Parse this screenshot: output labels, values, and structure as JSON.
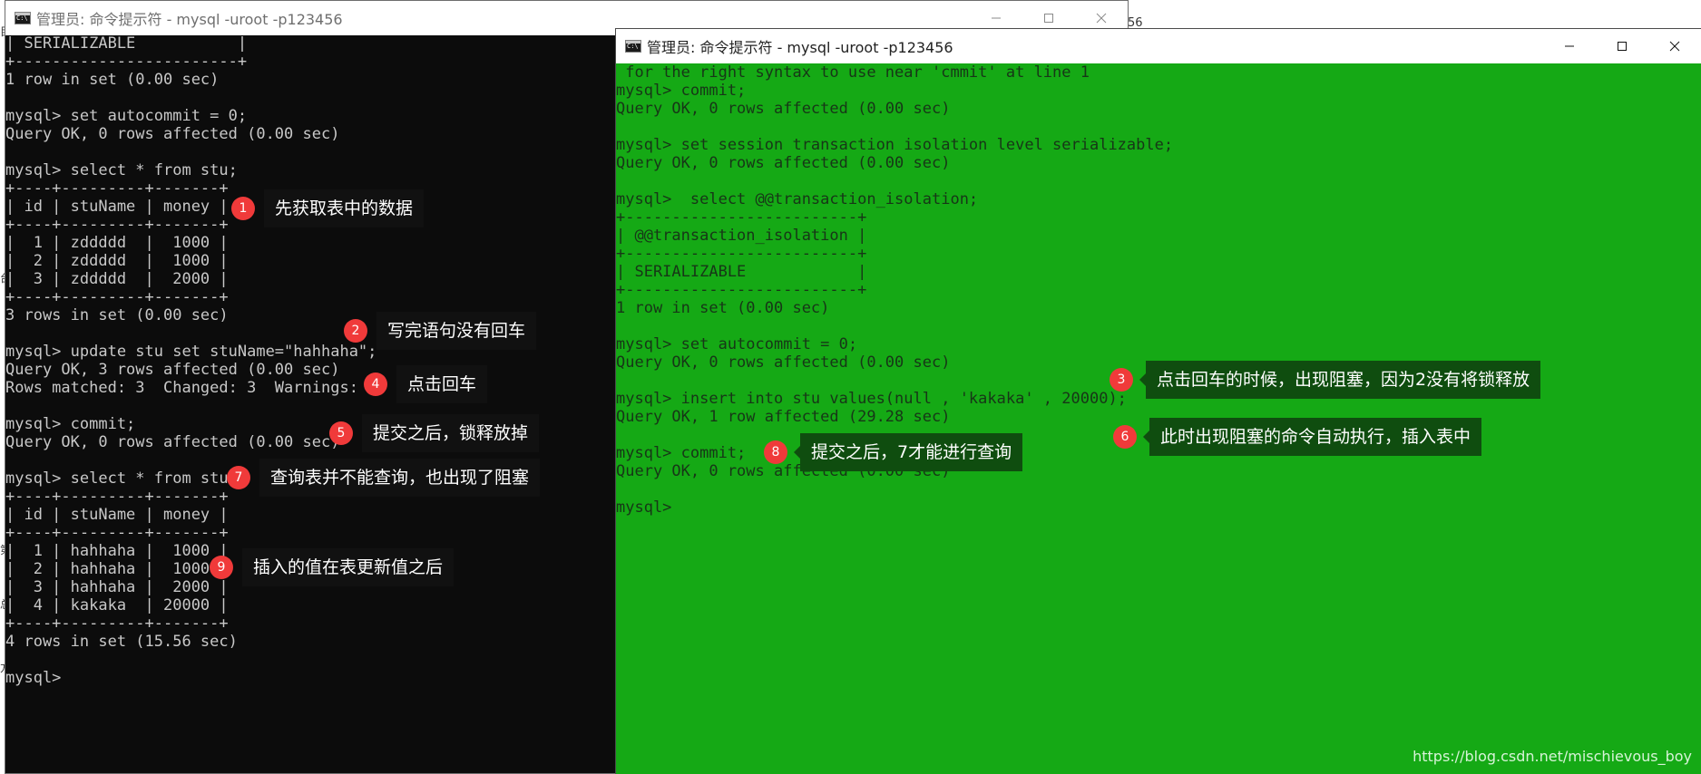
{
  "background": {
    "left_edge_chars": [
      "目",
      "台",
      "第",
      "总",
      "方"
    ],
    "top_right_fragment": "56"
  },
  "window1": {
    "title": "管理员: 命令提示符 - mysql  -uroot -p123456",
    "console_lines": [
      "| SERIALIZABLE           |",
      "+------------------------+",
      "1 row in set (0.00 sec)",
      "",
      "mysql> set autocommit = 0;",
      "Query OK, 0 rows affected (0.00 sec)",
      "",
      "mysql> select * from stu;",
      "+----+---------+-------+",
      "| id | stuName | money |",
      "+----+---------+-------+",
      "|  1 | zddddd  |  1000 |",
      "|  2 | zddddd  |  1000 |",
      "|  3 | zddddd  |  2000 |",
      "+----+---------+-------+",
      "3 rows in set (0.00 sec)",
      "",
      "mysql> update stu set stuName=\"hahhaha\";",
      "Query OK, 3 rows affected (0.00 sec)",
      "Rows matched: 3  Changed: 3  Warnings: 0",
      "",
      "mysql> commit;",
      "Query OK, 0 rows affected (0.00 sec)",
      "",
      "mysql> select * from stu;",
      "+----+---------+-------+",
      "| id | stuName | money |",
      "+----+---------+-------+",
      "|  1 | hahhaha |  1000 |",
      "|  2 | hahhaha |  1000 |",
      "|  3 | hahhaha |  2000 |",
      "|  4 | kakaka  | 20000 |",
      "+----+---------+-------+",
      "4 rows in set (15.56 sec)",
      "",
      "mysql> "
    ]
  },
  "window2": {
    "title": "管理员: 命令提示符 - mysql  -uroot -p123456",
    "console_lines": [
      " for the right syntax to use near 'cmmit' at line 1",
      "mysql> commit;",
      "Query OK, 0 rows affected (0.00 sec)",
      "",
      "mysql> set session transaction isolation level serializable;",
      "Query OK, 0 rows affected (0.00 sec)",
      "",
      "mysql>  select @@transaction_isolation;",
      "+-------------------------+",
      "| @@transaction_isolation |",
      "+-------------------------+",
      "| SERIALIZABLE            |",
      "+-------------------------+",
      "1 row in set (0.00 sec)",
      "",
      "mysql> set autocommit = 0;",
      "Query OK, 0 rows affected (0.00 sec)",
      "",
      "mysql> insert into stu values(null , 'kakaka' , 20000);",
      "Query OK, 1 row affected (29.28 sec)",
      "",
      "mysql> commit;",
      "Query OK, 0 rows affected (0.00 sec)",
      "",
      "mysql> "
    ]
  },
  "callouts": [
    {
      "num": "1",
      "text": "先获取表中的数据"
    },
    {
      "num": "2",
      "text": "写完语句没有回车"
    },
    {
      "num": "3",
      "text": "点击回车的时候，出现阻塞，因为2没有将锁释放"
    },
    {
      "num": "4",
      "text": "点击回车"
    },
    {
      "num": "5",
      "text": "提交之后，锁释放掉"
    },
    {
      "num": "6",
      "text": "此时出现阻塞的命令自动执行，插入表中"
    },
    {
      "num": "7",
      "text": "查询表并不能查询，也出现了阻塞"
    },
    {
      "num": "8",
      "text": "提交之后，7才能进行查询"
    },
    {
      "num": "9",
      "text": "插入的值在表更新值之后"
    }
  ],
  "watermark": "https://blog.csdn.net/mischievous_boy"
}
